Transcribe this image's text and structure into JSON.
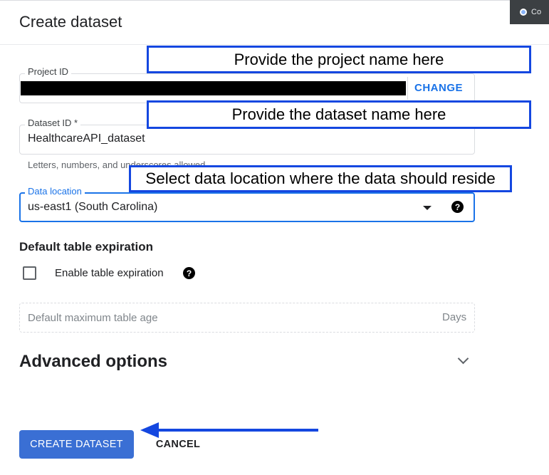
{
  "window": {
    "corner_chip_label": "Co"
  },
  "dialog": {
    "title": "Create dataset"
  },
  "project_id": {
    "label": "Project ID",
    "change_label": "CHANGE"
  },
  "dataset_id": {
    "label": "Dataset ID *",
    "value": "HealthcareAPI_dataset",
    "hint": "Letters, numbers, and underscores allowed"
  },
  "data_location": {
    "label": "Data location",
    "value": "us-east1 (South Carolina)"
  },
  "table_expiration": {
    "heading": "Default table expiration",
    "checkbox_label": "Enable table expiration",
    "checked": false,
    "max_age_placeholder": "Default maximum table age",
    "max_age_suffix": "Days"
  },
  "advanced": {
    "heading": "Advanced options"
  },
  "actions": {
    "create_label": "CREATE DATASET",
    "cancel_label": "CANCEL"
  },
  "annotations": [
    {
      "text": "Provide the project name here"
    },
    {
      "text": "Provide the dataset name here"
    },
    {
      "text": "Select data location where the data should reside"
    }
  ],
  "icons": {
    "help": "help-icon",
    "dropdown": "dropdown-arrow-icon",
    "expand": "chevron-down-icon",
    "annotation_arrow": "arrow-left-icon"
  },
  "colors": {
    "accent": "#1a73e8",
    "primary_button": "#3a6fd4",
    "annotation": "#1447e0",
    "redaction": "#000000"
  }
}
